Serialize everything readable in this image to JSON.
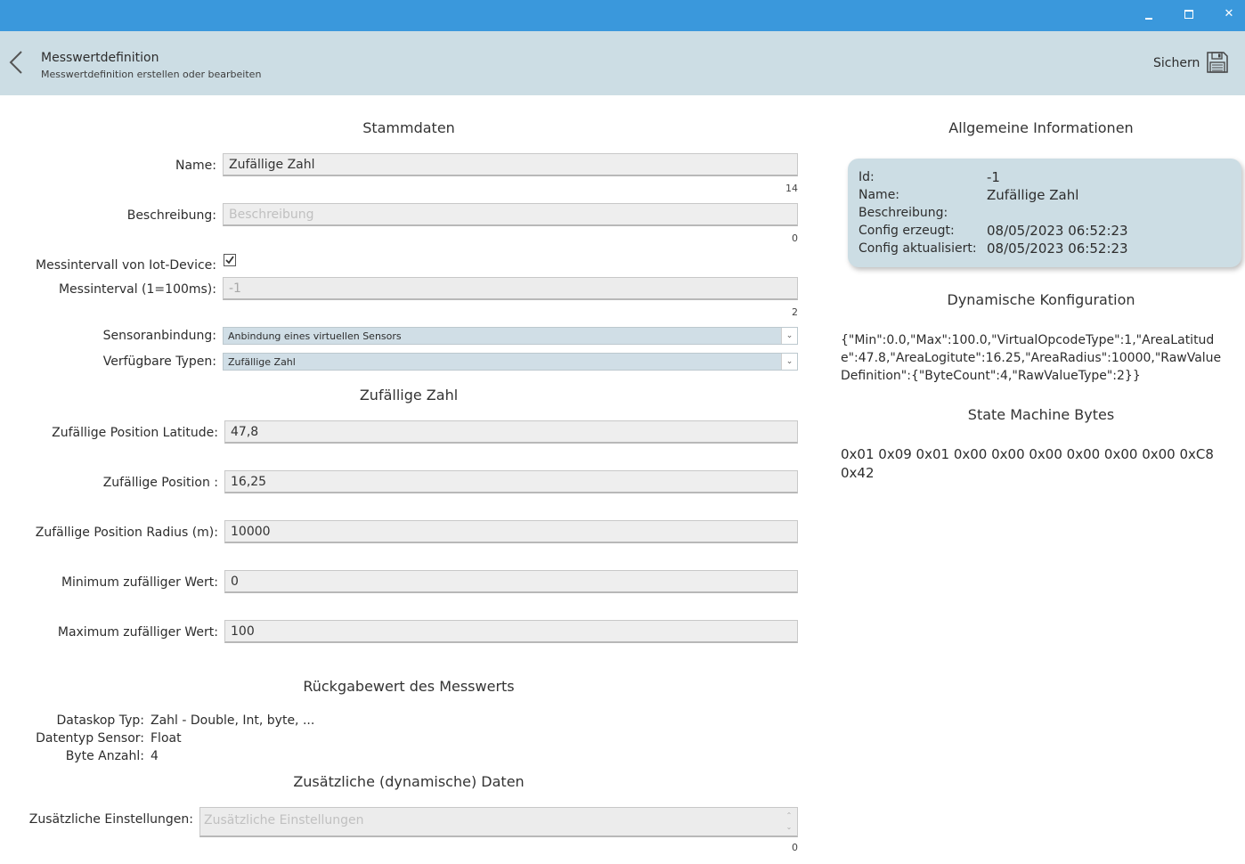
{
  "header": {
    "title": "Messwertdefinition",
    "subtitle": "Messwertdefinition erstellen oder bearbeiten",
    "save_label": "Sichern"
  },
  "stammdaten": {
    "title": "Stammdaten",
    "name_label": "Name:",
    "name_value": "Zufällige Zahl",
    "name_count": "14",
    "desc_label": "Beschreibung:",
    "desc_placeholder": "Beschreibung",
    "desc_count": "0",
    "iot_label": "Messintervall von Iot-Device:",
    "iot_checked": true,
    "interval_label": "Messinterval (1=100ms):",
    "interval_value": "-1",
    "interval_count": "2",
    "sensor_label": "Sensoranbindung:",
    "sensor_value": "Anbindung eines virtuellen Sensors",
    "types_label": "Verfügbare Typen:",
    "types_value": "Zufällige Zahl"
  },
  "random": {
    "title": "Zufällige Zahl",
    "fields": [
      {
        "label": "Zufällige Position Latitude:",
        "value": "47,8"
      },
      {
        "label": "Zufällige Position :",
        "value": "16,25"
      },
      {
        "label": "Zufällige Position Radius (m):",
        "value": "10000"
      },
      {
        "label": "Minimum zufälliger Wert:",
        "value": "0"
      },
      {
        "label": "Maximum zufälliger Wert:",
        "value": "100"
      }
    ]
  },
  "return_value": {
    "title": "Rückgabewert des Messwerts",
    "rows": [
      {
        "label": "Dataskop Typ:",
        "value": "Zahl - Double, Int, byte, ..."
      },
      {
        "label": "Datentyp Sensor:",
        "value": "Float"
      },
      {
        "label": "Byte Anzahl:",
        "value": "4"
      }
    ]
  },
  "additional": {
    "title": "Zusätzliche (dynamische) Daten",
    "label": "Zusätzliche Einstellungen:",
    "placeholder": "Zusätzliche Einstellungen",
    "count": "0"
  },
  "info": {
    "title": "Allgemeine Informationen",
    "rows": [
      {
        "key": "Id:",
        "value": "-1"
      },
      {
        "key": "Name:",
        "value": "Zufällige Zahl"
      },
      {
        "key": "Beschreibung:",
        "value": ""
      },
      {
        "key": "Config erzeugt:",
        "value": "08/05/2023 06:52:23"
      },
      {
        "key": "Config aktualisiert:",
        "value": "08/05/2023 06:52:23"
      }
    ]
  },
  "dynamic_config": {
    "title": "Dynamische Konfiguration",
    "text": "{\"Min\":0.0,\"Max\":100.0,\"VirtualOpcodeType\":1,\"AreaLatitude\":47.8,\"AreaLogitute\":16.25,\"AreaRadius\":10000,\"RawValueDefinition\":{\"ByteCount\":4,\"RawValueType\":2}}"
  },
  "state_machine": {
    "title": "State Machine Bytes",
    "text": "0x01 0x09 0x01 0x00 0x00 0x00 0x00 0x00 0x00 0xC8 0x42"
  },
  "icons": {
    "back": "chevron-left-icon",
    "save": "floppy-disk-icon",
    "minimize": "minimize-icon",
    "maximize": "maximize-icon",
    "close": "close-icon"
  },
  "colors": {
    "titlebar": "#3a98dc",
    "header": "#ccdde4",
    "select": "#d0dee6"
  }
}
